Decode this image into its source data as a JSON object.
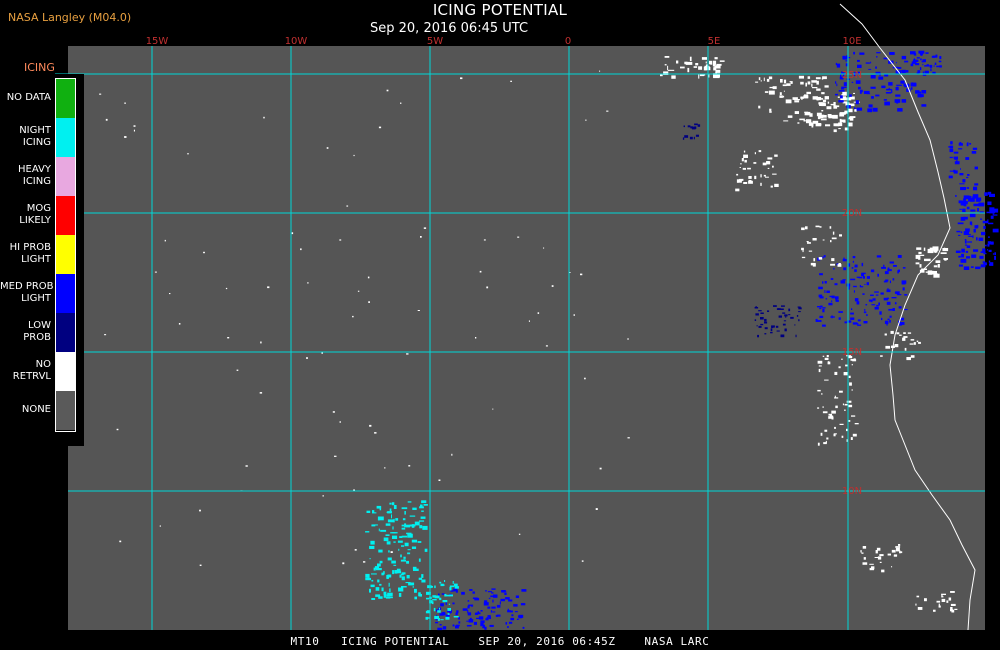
{
  "header": {
    "source": "NASA Langley (M04.0)",
    "title": "ICING POTENTIAL",
    "time": "Sep 20, 2016 06:45 UTC"
  },
  "legend": {
    "title": "ICING",
    "items": [
      {
        "label": "NO DATA",
        "color": "#10b010"
      },
      {
        "label": "NIGHT\nICING",
        "color": "#00f0f0"
      },
      {
        "label": "HEAVY\nICING",
        "color": "#e8a8e0"
      },
      {
        "label": "MOG\nLIKELY",
        "color": "#ff0000"
      },
      {
        "label": "HI PROB\nLIGHT",
        "color": "#ffff00"
      },
      {
        "label": "MED PROB\nLIGHT",
        "color": "#0000ff"
      },
      {
        "label": "LOW\nPROB",
        "color": "#000080"
      },
      {
        "label": "NO\nRETRVL",
        "color": "#ffffff"
      },
      {
        "label": "NONE",
        "color": "#5a5a5a"
      }
    ]
  },
  "map": {
    "background": "#555555",
    "grid_color": "#00d8d8",
    "grid_label_color": "#c03030",
    "lon_labels": [
      "15W",
      "10W",
      "5W",
      "0",
      "5E",
      "10E"
    ],
    "lat_labels": [
      "25N",
      "20N",
      "15N",
      "10N"
    ]
  },
  "footer": {
    "text": "MT10   ICING POTENTIAL    SEP 20, 2016 06:45Z    NASA LARC"
  }
}
